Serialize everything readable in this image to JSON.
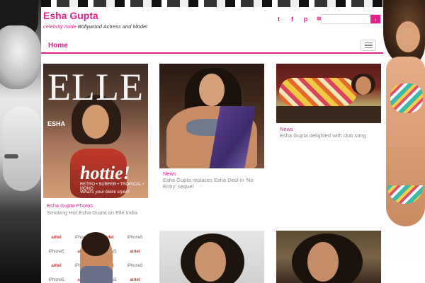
{
  "site": {
    "title": "Esha Gupta",
    "tagline_link": "celebrity nude",
    "tagline_text": " Bollywood Actress and Model"
  },
  "social": {
    "twitter": "t",
    "facebook": "f",
    "pinterest": "p",
    "rss": "≋"
  },
  "search": {
    "placeholder": "",
    "button": "›"
  },
  "nav": {
    "home": "Home"
  },
  "cards": [
    {
      "category": "Esha Gupta Photos",
      "title": "Smoking Hot Esha Gupta on Elle India",
      "image": {
        "logo": "ELLE",
        "cover_name": "ESHA",
        "headline": "hottie!",
        "tagline": "RETRO • SURFER • TROPICAL • MONO",
        "subline": "What's your bikini style?"
      }
    },
    {
      "category": "News",
      "title": "Esha Gupta replaces Esha Deol in 'No Entry' sequel"
    },
    {
      "category": "News",
      "title": "Esha Gupta delighted with club song"
    },
    {
      "category": "",
      "title": "",
      "image": {
        "brand": "airtel",
        "phone": "iPhone5"
      }
    },
    {
      "category": "",
      "title": ""
    },
    {
      "category": "",
      "title": ""
    }
  ]
}
